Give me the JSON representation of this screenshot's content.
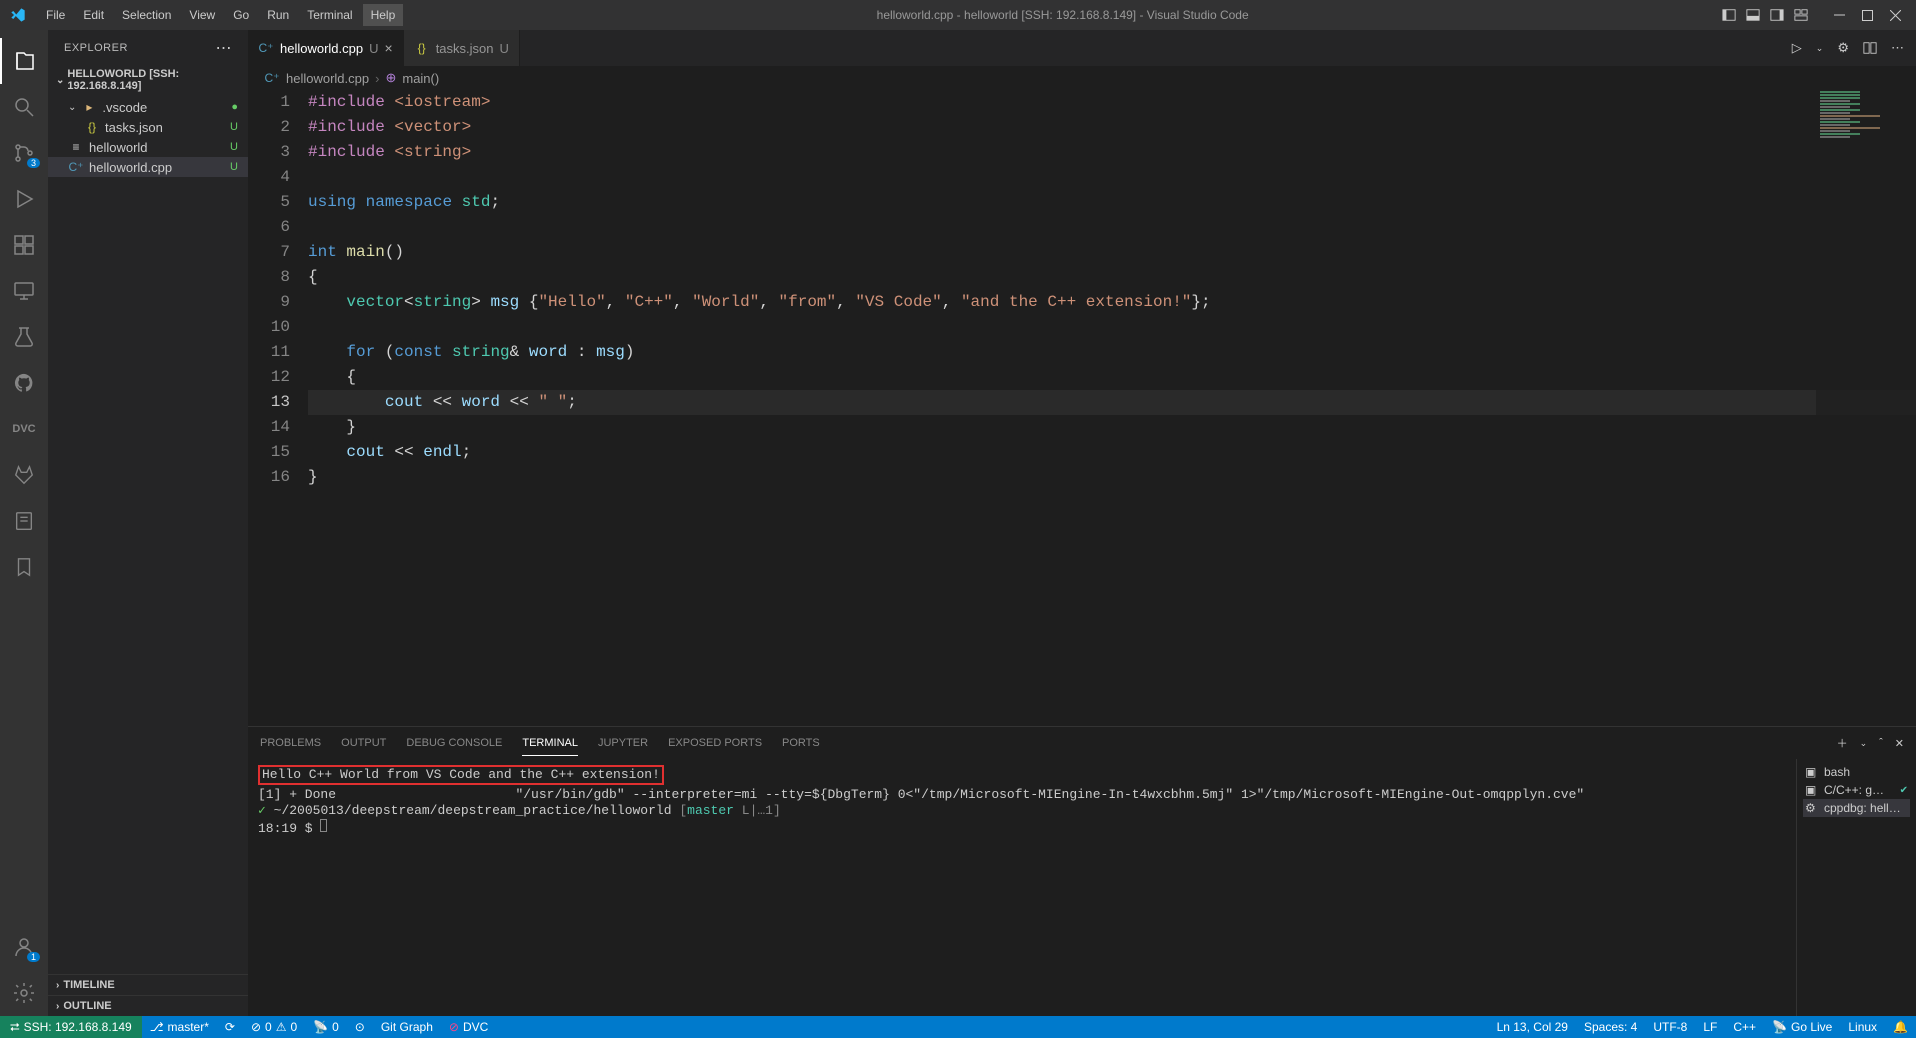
{
  "titlebar": {
    "menu": [
      "File",
      "Edit",
      "Selection",
      "View",
      "Go",
      "Run",
      "Terminal",
      "Help"
    ],
    "active_menu_index": 7,
    "title": "helloworld.cpp - helloworld [SSH: 192.168.8.149] - Visual Studio Code"
  },
  "activitybar": {
    "items": [
      {
        "name": "explorer",
        "active": true,
        "badge": null
      },
      {
        "name": "search",
        "active": false,
        "badge": null
      },
      {
        "name": "source-control",
        "active": false,
        "badge": "3"
      },
      {
        "name": "run-debug",
        "active": false,
        "badge": null
      },
      {
        "name": "extensions",
        "active": false,
        "badge": null
      },
      {
        "name": "remote-explorer",
        "active": false,
        "badge": null
      },
      {
        "name": "testing",
        "active": false,
        "badge": null
      },
      {
        "name": "github",
        "active": false,
        "badge": null
      },
      {
        "name": "dvc",
        "active": false,
        "badge": null
      },
      {
        "name": "gitlab",
        "active": false,
        "badge": null
      },
      {
        "name": "project-manager",
        "active": false,
        "badge": null
      },
      {
        "name": "bookmarks",
        "active": false,
        "badge": null
      }
    ],
    "bottom": [
      {
        "name": "accounts",
        "badge": "1"
      },
      {
        "name": "manage",
        "badge": null
      }
    ]
  },
  "sidebar": {
    "header": "EXPLORER",
    "folder_label": "HELLOWORLD [SSH: 192.168.8.149]",
    "tree": [
      {
        "type": "folder",
        "label": ".vscode",
        "status": "dot",
        "indent": 0
      },
      {
        "type": "file",
        "label": "tasks.json",
        "icon": "json",
        "status": "U",
        "indent": 1
      },
      {
        "type": "file",
        "label": "helloworld",
        "icon": "generic",
        "status": "U",
        "indent": 0
      },
      {
        "type": "file",
        "label": "helloworld.cpp",
        "icon": "cpp",
        "status": "U",
        "indent": 0,
        "selected": true
      }
    ],
    "sections": [
      "TIMELINE",
      "OUTLINE"
    ]
  },
  "tabs": {
    "items": [
      {
        "label": "helloworld.cpp",
        "icon": "cpp",
        "modified": "U",
        "active": true,
        "closable": true
      },
      {
        "label": "tasks.json",
        "icon": "json",
        "modified": "U",
        "active": false,
        "closable": false
      }
    ]
  },
  "breadcrumb": {
    "file_icon": "cpp",
    "file": "helloworld.cpp",
    "symbol_icon": "fn",
    "symbol": "main()"
  },
  "editor": {
    "current_line": 13,
    "lines": [
      {
        "n": 1,
        "html": "<span class='tok-pre'>#include</span> <span class='tok-str'>&lt;iostream&gt;</span>"
      },
      {
        "n": 2,
        "html": "<span class='tok-pre'>#include</span> <span class='tok-str'>&lt;vector&gt;</span>"
      },
      {
        "n": 3,
        "html": "<span class='tok-pre'>#include</span> <span class='tok-str'>&lt;string&gt;</span>"
      },
      {
        "n": 4,
        "html": ""
      },
      {
        "n": 5,
        "html": "<span class='tok-kw'>using</span> <span class='tok-kw'>namespace</span> <span class='tok-ns'>std</span>;"
      },
      {
        "n": 6,
        "html": ""
      },
      {
        "n": 7,
        "html": "<span class='tok-kw'>int</span> <span class='tok-fn'>main</span>()"
      },
      {
        "n": 8,
        "html": "{"
      },
      {
        "n": 9,
        "html": "    <span class='tok-type'>vector</span>&lt;<span class='tok-type'>string</span>&gt; <span class='tok-var'>msg</span> {<span class='tok-str'>\"Hello\"</span>, <span class='tok-str'>\"C++\"</span>, <span class='tok-str'>\"World\"</span>, <span class='tok-str'>\"from\"</span>, <span class='tok-str'>\"VS Code\"</span>, <span class='tok-str'>\"and the C++ extension!\"</span>};"
      },
      {
        "n": 10,
        "html": ""
      },
      {
        "n": 11,
        "html": "    <span class='tok-kw'>for</span> (<span class='tok-kw'>const</span> <span class='tok-type'>string</span>&amp; <span class='tok-var'>word</span> : <span class='tok-var'>msg</span>)"
      },
      {
        "n": 12,
        "html": "    {"
      },
      {
        "n": 13,
        "html": "        <span class='tok-var'>cout</span> &lt;&lt; <span class='tok-var'>word</span> &lt;&lt; <span class='tok-str'>\" \"</span>;"
      },
      {
        "n": 14,
        "html": "    }"
      },
      {
        "n": 15,
        "html": "    <span class='tok-var'>cout</span> &lt;&lt; <span class='tok-var'>endl</span>;"
      },
      {
        "n": 16,
        "html": "}"
      }
    ]
  },
  "panel": {
    "tabs": [
      "PROBLEMS",
      "OUTPUT",
      "DEBUG CONSOLE",
      "TERMINAL",
      "JUPYTER",
      "EXPOSED PORTS",
      "PORTS"
    ],
    "active_tab_index": 3,
    "terminal": {
      "output_highlight": "Hello C++ World from VS Code and the C++ extension!",
      "line2": "[1] + Done                       \"/usr/bin/gdb\" --interpreter=mi --tty=${DbgTerm} 0<\"/tmp/Microsoft-MIEngine-In-t4wxcbhm.5mj\" 1>\"/tmp/Microsoft-MIEngine-Out-omqpplyn.cve\"",
      "prompt_path": "~/2005013/deepstream/deepstream_practice/helloworld",
      "branch": "master",
      "branch_extra": "L|…1",
      "time": "18:19",
      "prompt_symbol": "$"
    },
    "terminal_list": [
      {
        "icon": "bash",
        "label": "bash"
      },
      {
        "icon": "bash",
        "label": "C/C++: g…",
        "check": true
      },
      {
        "icon": "debug",
        "label": "cppdbg: hell…",
        "selected": true
      }
    ]
  },
  "statusbar": {
    "remote": "SSH: 192.168.8.149",
    "branch": "master*",
    "sync": "⟳",
    "errors": "0",
    "warnings": "0",
    "radio": "0",
    "git_graph": "Git Graph",
    "dvc": "DVC",
    "right": {
      "cursor": "Ln 13, Col 29",
      "spaces": "Spaces: 4",
      "encoding": "UTF-8",
      "eol": "LF",
      "lang": "C++",
      "golive": "Go Live",
      "os": "Linux",
      "bell": "notifications"
    }
  }
}
